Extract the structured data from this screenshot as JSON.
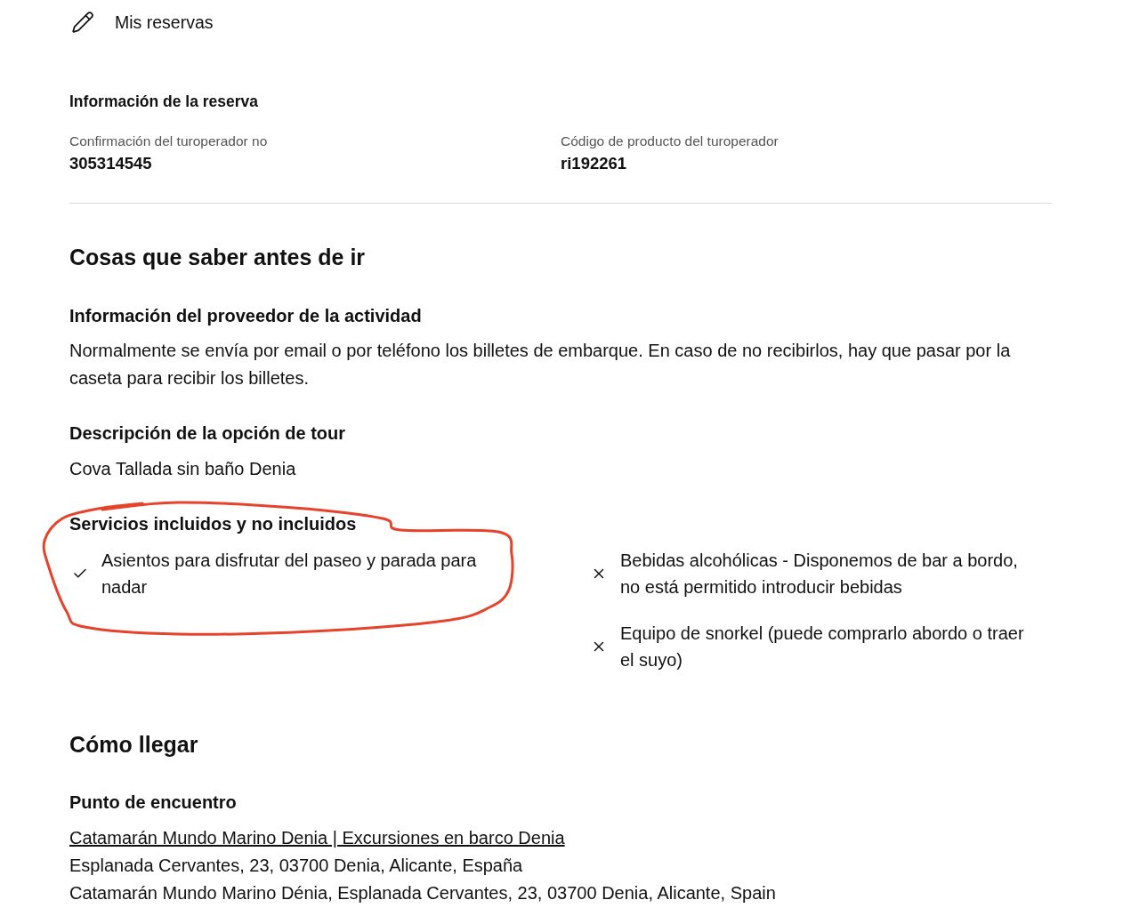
{
  "header": {
    "title": "Mis reservas"
  },
  "booking_info": {
    "title": "Información de la reserva",
    "fields": [
      {
        "label": "Confirmación del turoperador no",
        "value": "305314545"
      },
      {
        "label": "Código de producto del turoperador",
        "value": "ri192261"
      }
    ]
  },
  "things_to_know": {
    "title": "Cosas que saber antes de ir",
    "provider_info": {
      "title": "Información del proveedor de la actividad",
      "text": "Normalmente se envía por email o por teléfono los billetes de embarque. En caso de no recibirlos, hay que pasar por la caseta para recibir los billetes."
    },
    "tour_option": {
      "title": "Descripción de la opción de tour",
      "text": "Cova Tallada sin baño Denia"
    },
    "services": {
      "title": "Servicios incluidos y no incluidos",
      "circled": true,
      "items": [
        {
          "kind": "included",
          "text": "Asientos para disfrutar del paseo y parada para nadar"
        },
        {
          "kind": "excluded",
          "text": "Bebidas alcohólicas - Disponemos de bar a bordo, no está permitido introducir bebidas"
        },
        {
          "kind": "excluded",
          "text": "Equipo de snorkel (puede comprarlo abordo o traer el suyo)"
        }
      ]
    }
  },
  "getting_there": {
    "title": "Cómo llegar",
    "meeting_point": {
      "title": "Punto de encuentro",
      "link": "Catamarán Mundo Marino Denia | Excursiones en barco Denia",
      "lines": [
        "Esplanada Cervantes, 23, 03700 Denia, Alicante, España",
        "Catamarán Mundo Marino Dénia, Esplanada Cervantes, 23, 03700 Denia, Alicante, Spain"
      ]
    }
  }
}
